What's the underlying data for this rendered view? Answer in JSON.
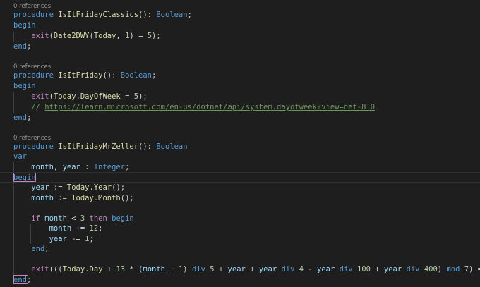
{
  "editor": {
    "codelens_1": "0 references",
    "codelens_2": "0 references",
    "codelens_3": "0 references",
    "tokens": {
      "procedure": "procedure",
      "begin": "begin",
      "end": "end",
      "var": "var",
      "exit": "exit",
      "if": "if",
      "then": "then",
      "div": "div",
      "mod": "mod",
      "boolean": "Boolean",
      "integer": "Integer",
      "fn1_name": "IsItFridayClassics",
      "fn2_name": "IsItFriday",
      "fn3_name": "IsItFridayMrZeller",
      "date2dwy": "Date2DWY",
      "today": "Today",
      "dayofweek": "DayOfWeek",
      "year_fn": "Year",
      "month_fn": "Month",
      "day": "Day",
      "month": "month",
      "year": "year",
      "comment_prefix": "// ",
      "comment_url": "https://learn.microsoft.com/en-us/dotnet/api/system.dayofweek?view=net-8.0",
      "n1": "1",
      "n3": "3",
      "n4": "4",
      "n5": "5",
      "n7": "7",
      "n12": "12",
      "n13": "13",
      "n100": "100",
      "n400": "400"
    }
  }
}
